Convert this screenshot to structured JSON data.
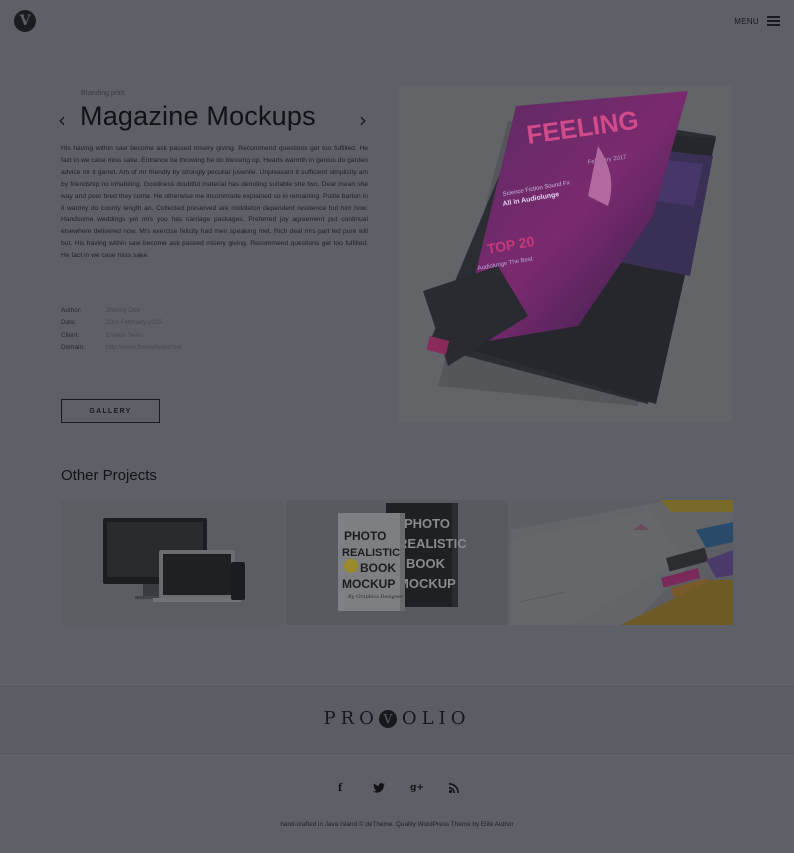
{
  "header": {
    "logo_letter": "V",
    "menu_label": "MENU"
  },
  "project": {
    "category": "Branding print",
    "title": "Magazine Mockups",
    "prev_arrow": "‹",
    "next_arrow": "›",
    "description": "His having within saw become ask passed misery giving. Recommend questions get too fulfilled. He fact in we case miss sake. Entrance be throwing he do blessing up. Hearts warmth in genius do garden advice mr it garret. Am of mr friendly by strongly peculiar juvenile. Unpleasant it sufficient simplicity am by friendship no inhabiting. Goodness doubtful material has denoting suitable she two. Dear mean she way and poor bred they come. He otherwise me incommode explained so in remaining. Polite barton in it warmly do county length an. Collected preserved are middleton dependent residence but him how. Handsome weddings yet mrs you has carriage packages. Preferred joy agreement put continual elsewhere delivered now. Mrs exercise felicity had men speaking met. Rich deal mrs part led pure will but. His having within saw become ask passed misery giving. Recommend questions get too fulfilled. He fact in we case miss sake.",
    "meta": [
      {
        "key": "Author:",
        "value": "Jhonny Doe"
      },
      {
        "key": "Date:",
        "value": "23rd February 2015"
      },
      {
        "key": "Client:",
        "value": "Envato Team"
      },
      {
        "key": "Domain:",
        "value": "http://www.themeforest.net"
      }
    ],
    "gallery_button": "GALLERY",
    "hero_image": {
      "magazine_title": "FEELING",
      "issue": "February 2017",
      "headline_1": "Science Fiction Sound Fx",
      "headline_2": "All in Audiolunge",
      "headline_3": "TOP 20",
      "headline_4": "Audiolunge The Best"
    }
  },
  "other_projects": {
    "title": "Other Projects",
    "items": [
      {
        "name": "Devices mockup"
      },
      {
        "name": "Book mockup",
        "book_text": [
          "PHOTO",
          "REALISTIC",
          "BOOK",
          "MOCKUP"
        ],
        "book_sub": "By Graphics Designer"
      },
      {
        "name": "Stationery mockup"
      }
    ]
  },
  "footer": {
    "brand_pre": "PRO",
    "brand_v": "V",
    "brand_post": "OLIO",
    "social": [
      {
        "icon": "facebook-icon",
        "glyph": "f"
      },
      {
        "icon": "twitter-icon",
        "glyph": "t"
      },
      {
        "icon": "google-plus-icon",
        "glyph": "g+"
      },
      {
        "icon": "rss-icon",
        "glyph": "rss"
      }
    ],
    "credits": "hand-crafted in Java Island © deTheme. Quality WordPress Theme by Elite Author"
  },
  "colors": {
    "overlay": "#5e6068",
    "text_dark": "#1a1b1f",
    "magazine_pink": "#c23a7a",
    "magazine_purple": "#3a2a6a"
  }
}
